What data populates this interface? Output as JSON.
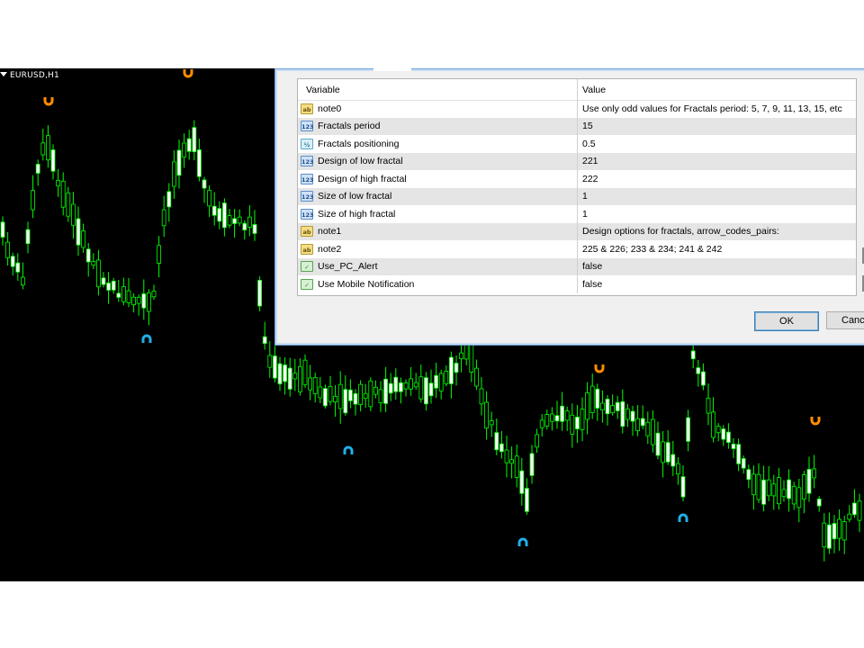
{
  "chart": {
    "symbol_label": "EURUSD,H1",
    "bull_color": "#ffffff",
    "bear_color": "#00ff00",
    "wick_color": "#00ff00",
    "high_fractal_color": "#ff8c00",
    "low_fractal_color": "#1fb0e8"
  },
  "dialog": {
    "columns": {
      "variable": "Variable",
      "value": "Value"
    },
    "rows": [
      {
        "icon": "ab",
        "variable": "note0",
        "value": "Use only odd values for Fractals period: 5, 7, 9, 11, 13, 15, etc"
      },
      {
        "icon": "123",
        "variable": "Fractals period",
        "value": "15"
      },
      {
        "icon": "1/2",
        "variable": "Fractals positioning",
        "value": "0.5"
      },
      {
        "icon": "123",
        "variable": "Design of low fractal",
        "value": "221"
      },
      {
        "icon": "123",
        "variable": "Design of high fractal",
        "value": "222"
      },
      {
        "icon": "123",
        "variable": "Size of low fractal",
        "value": "1"
      },
      {
        "icon": "123",
        "variable": "Size of high fractal",
        "value": "1"
      },
      {
        "icon": "ab",
        "variable": "note1",
        "value": "Design options for fractals, arrow_codes_pairs:"
      },
      {
        "icon": "ab",
        "variable": "note2",
        "value": "225 & 226; 233 & 234; 241 & 242"
      },
      {
        "icon": "bool",
        "variable": "Use_PC_Alert",
        "value": "false"
      },
      {
        "icon": "bool",
        "variable": "Use Mobile Notification",
        "value": "false"
      }
    ],
    "ok_label": "OK",
    "cancel_label": "Canc"
  }
}
